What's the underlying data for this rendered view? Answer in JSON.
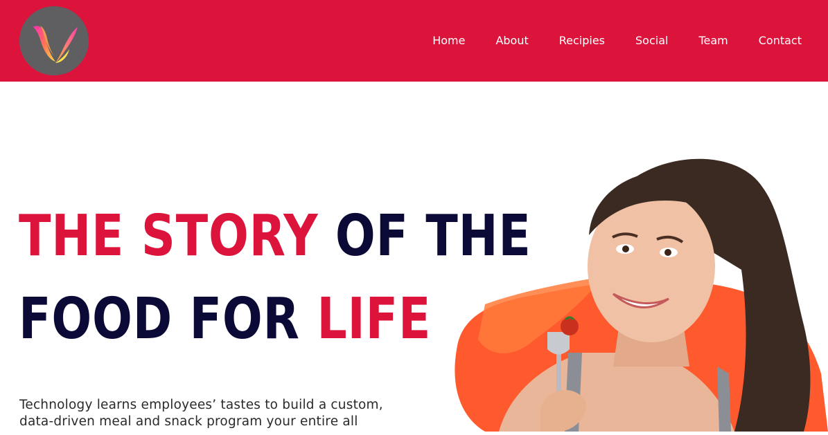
{
  "header": {
    "background": "#dc143c",
    "logo_icon": "v-flame-logo-icon",
    "nav": [
      {
        "label": "Home"
      },
      {
        "label": "About"
      },
      {
        "label": "Recipies"
      },
      {
        "label": "Social"
      },
      {
        "label": "Team"
      },
      {
        "label": "Contact"
      }
    ]
  },
  "hero": {
    "title_line1": [
      {
        "text": "THE ",
        "color": "red"
      },
      {
        "text": "STORY ",
        "color": "red"
      },
      {
        "text": "OF THE",
        "color": "navy"
      }
    ],
    "title_line2": [
      {
        "text": "FOOD FOR ",
        "color": "navy"
      },
      {
        "text": "LIFE",
        "color": "red"
      }
    ],
    "paragraph": "Technology learns employees’ tastes to build a custom, data-driven meal and snack program your entire all",
    "accent_colors": {
      "red": "#dc143c",
      "navy": "#0b0a36",
      "orange": "#ff5a2e"
    },
    "image": "woman-eating-tomato-illustration"
  }
}
